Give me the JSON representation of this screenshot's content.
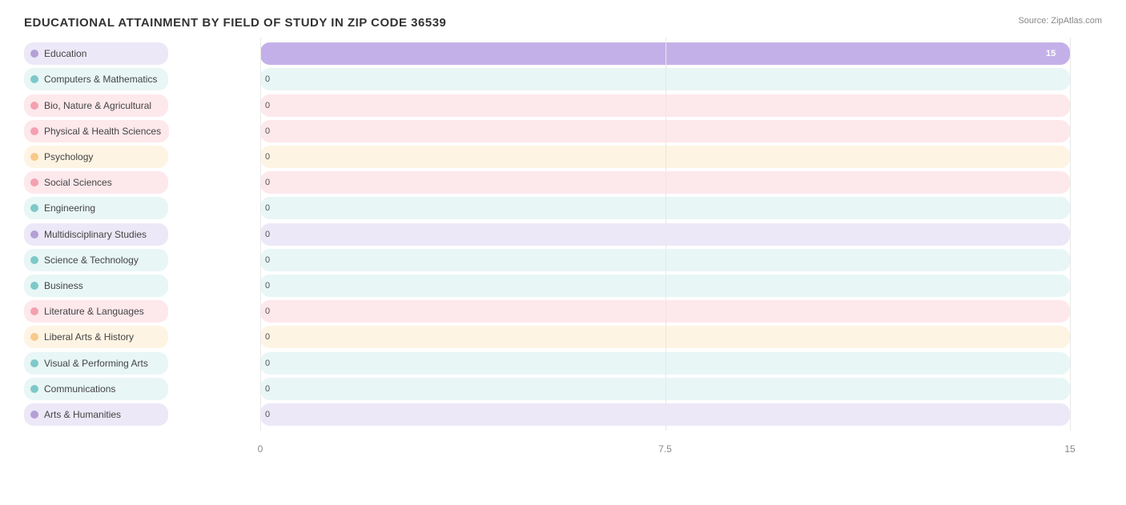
{
  "title": "EDUCATIONAL ATTAINMENT BY FIELD OF STUDY IN ZIP CODE 36539",
  "source": "Source: ZipAtlas.com",
  "chart": {
    "xaxis": {
      "ticks": [
        {
          "label": "0",
          "pct": 0
        },
        {
          "label": "7.5",
          "pct": 50
        },
        {
          "label": "15",
          "pct": 100
        }
      ]
    },
    "maxValue": 15,
    "bars": [
      {
        "label": "Education",
        "value": 15,
        "dotColor": "#b3a0d4",
        "barColor": "#c4b0e8",
        "bgColor": "#ede8f7"
      },
      {
        "label": "Computers & Mathematics",
        "value": 0,
        "dotColor": "#7ec8c8",
        "barColor": "#a0d8d8",
        "bgColor": "#e8f6f6"
      },
      {
        "label": "Bio, Nature & Agricultural",
        "value": 0,
        "dotColor": "#f4a0b0",
        "barColor": "#f4a0b0",
        "bgColor": "#fde8ec"
      },
      {
        "label": "Physical & Health Sciences",
        "value": 0,
        "dotColor": "#f4a0b0",
        "barColor": "#f4a0b0",
        "bgColor": "#fde8ec"
      },
      {
        "label": "Psychology",
        "value": 0,
        "dotColor": "#f7c98a",
        "barColor": "#f7c98a",
        "bgColor": "#fef4e4"
      },
      {
        "label": "Social Sciences",
        "value": 0,
        "dotColor": "#f4a0b0",
        "barColor": "#f4a0b0",
        "bgColor": "#fde8ec"
      },
      {
        "label": "Engineering",
        "value": 0,
        "dotColor": "#7ec8c8",
        "barColor": "#a0d8d8",
        "bgColor": "#e8f6f6"
      },
      {
        "label": "Multidisciplinary Studies",
        "value": 0,
        "dotColor": "#b3a0d4",
        "barColor": "#c4b0e8",
        "bgColor": "#ede8f7"
      },
      {
        "label": "Science & Technology",
        "value": 0,
        "dotColor": "#7ec8c8",
        "barColor": "#a0d8d8",
        "bgColor": "#e8f6f6"
      },
      {
        "label": "Business",
        "value": 0,
        "dotColor": "#7ec8c8",
        "barColor": "#a0d8d8",
        "bgColor": "#e8f6f6"
      },
      {
        "label": "Literature & Languages",
        "value": 0,
        "dotColor": "#f4a0b0",
        "barColor": "#f4a0b0",
        "bgColor": "#fde8ec"
      },
      {
        "label": "Liberal Arts & History",
        "value": 0,
        "dotColor": "#f7c98a",
        "barColor": "#f7c98a",
        "bgColor": "#fef4e4"
      },
      {
        "label": "Visual & Performing Arts",
        "value": 0,
        "dotColor": "#7ec8c8",
        "barColor": "#a0d8d8",
        "bgColor": "#e8f6f6"
      },
      {
        "label": "Communications",
        "value": 0,
        "dotColor": "#7ec8c8",
        "barColor": "#a0d8d8",
        "bgColor": "#e8f6f6"
      },
      {
        "label": "Arts & Humanities",
        "value": 0,
        "dotColor": "#b3a0d4",
        "barColor": "#c4b0e8",
        "bgColor": "#ede8f7"
      }
    ]
  }
}
